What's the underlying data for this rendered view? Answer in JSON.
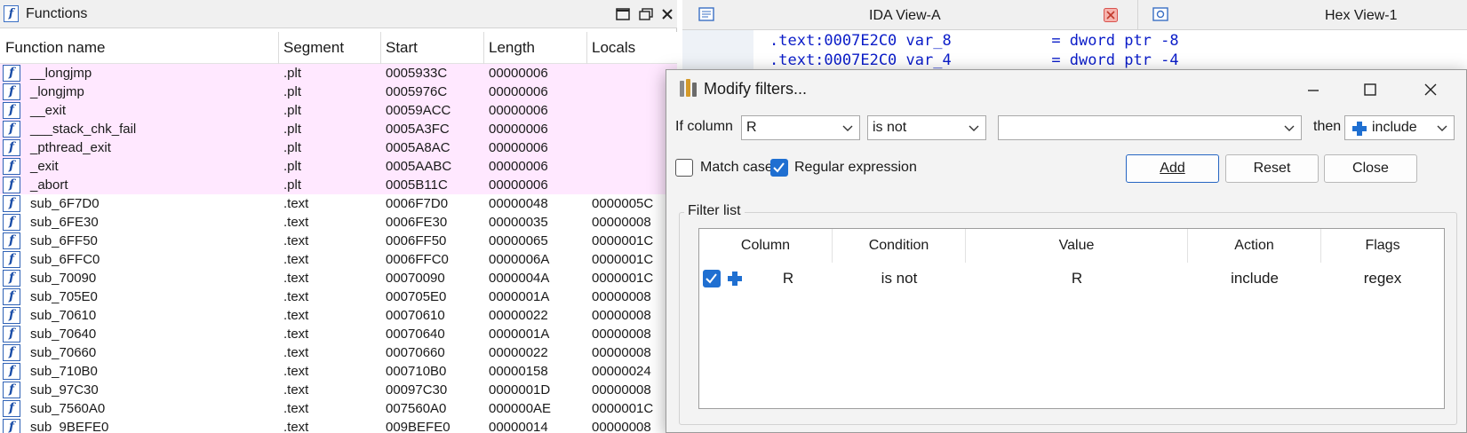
{
  "functions_panel": {
    "title": "Functions",
    "columns": [
      "Function name",
      "Segment",
      "Start",
      "Length",
      "Locals"
    ],
    "rows": [
      {
        "name": "__longjmp",
        "segment": ".plt",
        "start": "0005933C",
        "length": "00000006",
        "locals": "",
        "highlight": true
      },
      {
        "name": "_longjmp",
        "segment": ".plt",
        "start": "0005976C",
        "length": "00000006",
        "locals": "",
        "highlight": true
      },
      {
        "name": "__exit",
        "segment": ".plt",
        "start": "00059ACC",
        "length": "00000006",
        "locals": "",
        "highlight": true
      },
      {
        "name": "___stack_chk_fail",
        "segment": ".plt",
        "start": "0005A3FC",
        "length": "00000006",
        "locals": "",
        "highlight": true
      },
      {
        "name": "_pthread_exit",
        "segment": ".plt",
        "start": "0005A8AC",
        "length": "00000006",
        "locals": "",
        "highlight": true
      },
      {
        "name": "_exit",
        "segment": ".plt",
        "start": "0005AABC",
        "length": "00000006",
        "locals": "",
        "highlight": true
      },
      {
        "name": "_abort",
        "segment": ".plt",
        "start": "0005B11C",
        "length": "00000006",
        "locals": "",
        "highlight": true
      },
      {
        "name": "sub_6F7D0",
        "segment": ".text",
        "start": "0006F7D0",
        "length": "00000048",
        "locals": "0000005C",
        "highlight": false
      },
      {
        "name": "sub_6FE30",
        "segment": ".text",
        "start": "0006FE30",
        "length": "00000035",
        "locals": "00000008",
        "highlight": false
      },
      {
        "name": "sub_6FF50",
        "segment": ".text",
        "start": "0006FF50",
        "length": "00000065",
        "locals": "0000001C",
        "highlight": false
      },
      {
        "name": "sub_6FFC0",
        "segment": ".text",
        "start": "0006FFC0",
        "length": "0000006A",
        "locals": "0000001C",
        "highlight": false
      },
      {
        "name": "sub_70090",
        "segment": ".text",
        "start": "00070090",
        "length": "0000004A",
        "locals": "0000001C",
        "highlight": false
      },
      {
        "name": "sub_705E0",
        "segment": ".text",
        "start": "000705E0",
        "length": "0000001A",
        "locals": "00000008",
        "highlight": false
      },
      {
        "name": "sub_70610",
        "segment": ".text",
        "start": "00070610",
        "length": "00000022",
        "locals": "00000008",
        "highlight": false
      },
      {
        "name": "sub_70640",
        "segment": ".text",
        "start": "00070640",
        "length": "0000001A",
        "locals": "00000008",
        "highlight": false
      },
      {
        "name": "sub_70660",
        "segment": ".text",
        "start": "00070660",
        "length": "00000022",
        "locals": "00000008",
        "highlight": false
      },
      {
        "name": "sub_710B0",
        "segment": ".text",
        "start": "000710B0",
        "length": "00000158",
        "locals": "00000024",
        "highlight": false
      },
      {
        "name": "sub_97C30",
        "segment": ".text",
        "start": "00097C30",
        "length": "0000001D",
        "locals": "00000008",
        "highlight": false
      },
      {
        "name": "sub_7560A0",
        "segment": ".text",
        "start": "007560A0",
        "length": "000000AE",
        "locals": "0000001C",
        "highlight": false
      },
      {
        "name": "sub_9BEFE0",
        "segment": ".text",
        "start": "009BEFE0",
        "length": "00000014",
        "locals": "00000008",
        "highlight": false
      }
    ]
  },
  "tabs": {
    "ida_view": "IDA View-A",
    "hex_view": "Hex View-1"
  },
  "code": {
    "lines": [
      {
        "addr": ".text:0007E2C0",
        "name": "var_8",
        "op": "= dword ptr",
        "val": "-8"
      },
      {
        "addr": ".text:0007E2C0",
        "name": "var_4",
        "op": "= dword ptr",
        "val": "-4"
      }
    ]
  },
  "dialog": {
    "title": "Modify filters...",
    "if_column_label": "If column",
    "column_value": "R",
    "condition_value": "is not",
    "filter_value": "",
    "then_label": "then",
    "action_value": "include",
    "match_case_label": "Match case",
    "match_case_checked": false,
    "regex_label": "Regular expression",
    "regex_checked": true,
    "add_label": "Add",
    "reset_label": "Reset",
    "close_label": "Close",
    "filter_list_label": "Filter list",
    "table_headers": [
      "Column",
      "Condition",
      "Value",
      "Action",
      "Flags"
    ],
    "filters": [
      {
        "enabled": true,
        "column": "R",
        "condition": "is not",
        "value": "R",
        "action": "include",
        "flags": "regex"
      }
    ]
  },
  "colors": {
    "plt_row_bg": "#ffe8ff",
    "accent_blue": "#1f6fd1",
    "code_blue": "#0a1cc8",
    "code_green": "#1a7a1a"
  }
}
